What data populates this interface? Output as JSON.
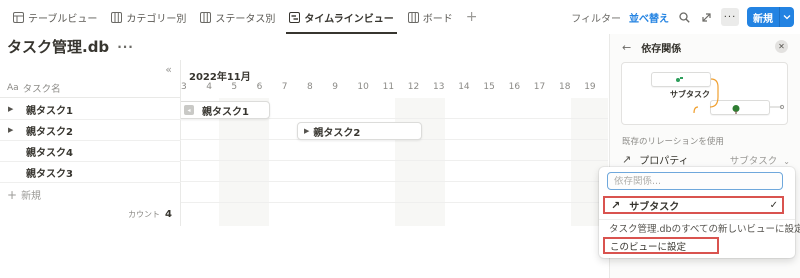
{
  "tabs": [
    {
      "label": "テーブルビュー",
      "icon": "table-icon",
      "active": false
    },
    {
      "label": "カテゴリー別",
      "icon": "board-icon",
      "active": false
    },
    {
      "label": "ステータス別",
      "icon": "board-icon",
      "active": false
    },
    {
      "label": "タイムラインビュー",
      "icon": "timeline-icon",
      "active": true
    },
    {
      "label": "ボード",
      "icon": "board-icon",
      "active": false
    }
  ],
  "toolbar": {
    "filter_label": "フィルター",
    "sort_label": "並べ替え",
    "new_label": "新規",
    "accent": "#2383e2"
  },
  "page": {
    "title": "タスク管理.db"
  },
  "table": {
    "column_header": "タスク名",
    "column_icon_text": "Aa",
    "rows": [
      {
        "name": "親タスク1",
        "expandable": true
      },
      {
        "name": "親タスク2",
        "expandable": true
      },
      {
        "name": "親タスク4",
        "expandable": false
      },
      {
        "name": "親タスク3",
        "expandable": false
      }
    ],
    "new_label": "新規",
    "count_label": "カウント",
    "count_value": "4"
  },
  "timeline": {
    "month": "2022年11月",
    "days": [
      "3",
      "4",
      "5",
      "6",
      "7",
      "8",
      "9",
      "10",
      "11",
      "12",
      "13",
      "14",
      "15",
      "16",
      "17",
      "18",
      "19"
    ],
    "bars": [
      {
        "label": "親タスク1"
      },
      {
        "label": "親タスク2"
      }
    ]
  },
  "panel": {
    "title": "依存関係",
    "preview_label": "サブタスク",
    "section_label": "既存のリレーションを使用",
    "property_name": "プロパティ",
    "property_value": "サブタスク"
  },
  "dropdown": {
    "search_placeholder": "依存関係...",
    "option": "サブタスク",
    "apply_all": "タスク管理.dbのすべての新しいビューに設定",
    "apply_this": "このビューに設定",
    "highlight_color": "#d9534f"
  }
}
